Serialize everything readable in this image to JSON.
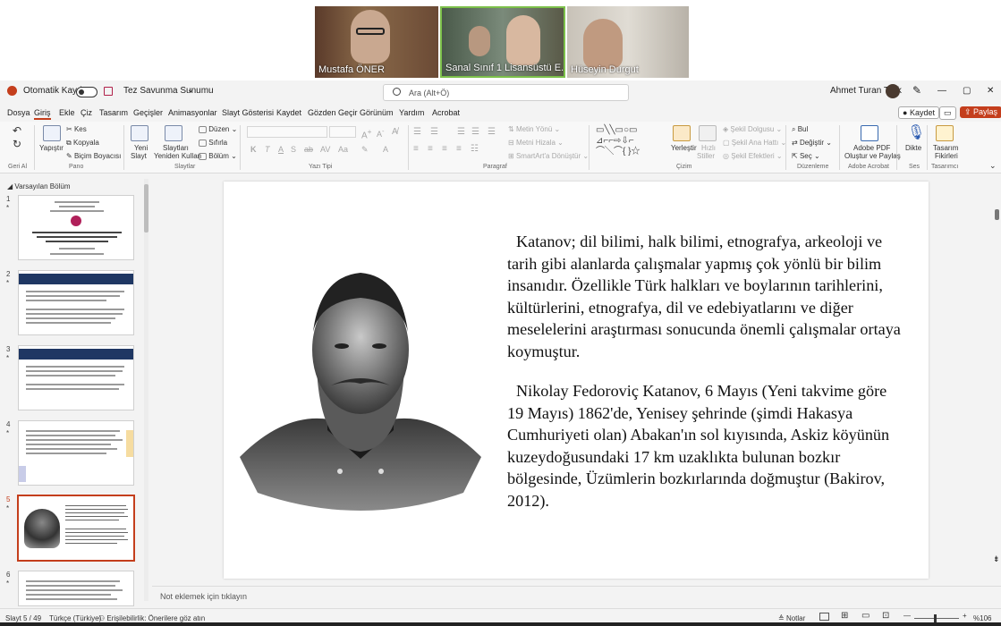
{
  "meeting": {
    "participants": [
      {
        "name": "Mustafa ÖNER"
      },
      {
        "name": "Sanal Sınıf 1 Lisansüstü E..."
      },
      {
        "name": "Hüseyin Durgut"
      }
    ]
  },
  "titlebar": {
    "autosave_label": "Otomatik Kaydet",
    "doc_title": "Tez Savunma Sunumu",
    "search_placeholder": "Ara (Alt+Ö)",
    "user_name": "Ahmet Turan Türk",
    "minimize": "—",
    "restore": "▢",
    "close": "✕"
  },
  "menu": {
    "items": [
      "Dosya",
      "Giriş",
      "Ekle",
      "Çiz",
      "Tasarım",
      "Geçişler",
      "Animasyonlar",
      "Slayt Gösterisi",
      "Kaydet",
      "Gözden Geçir",
      "Görünüm",
      "Yardım",
      "Acrobat"
    ],
    "record_label": "Kaydet",
    "share_label": "Paylaş"
  },
  "ribbon": {
    "undo_group": "Geri Al",
    "clipboard": {
      "paste": "Yapıştır",
      "cut": "Kes",
      "copy": "Kopyala",
      "format_painter": "Biçim Boyacısı",
      "group": "Pano"
    },
    "slides": {
      "new_slide": "Yeni",
      "new_slide2": "Slayt",
      "reuse": "Slaytları",
      "reuse2": "Yeniden Kullan",
      "layout": "Düzen",
      "reset": "Sıfırla",
      "section": "Bölüm",
      "group": "Slaytlar"
    },
    "font": {
      "group": "Yazı Tipi"
    },
    "paragraph": {
      "text_direction": "Metin Yönü",
      "align_text": "Metni Hizala",
      "smartart": "SmartArt'a Dönüştür",
      "group": "Paragraf"
    },
    "drawing": {
      "arrange": "Yerleştir",
      "quick_styles": "Hızlı",
      "quick_styles2": "Stiller",
      "shape_fill": "Şekil Dolgusu",
      "shape_outline": "Şekil Ana Hattı",
      "shape_effects": "Şekil Efektleri",
      "group": "Çizim"
    },
    "editing": {
      "find": "Bul",
      "replace": "Değiştir",
      "select": "Seç",
      "group": "Düzenleme"
    },
    "acrobat": {
      "create_pdf": "Adobe PDF",
      "create_pdf2": "Oluştur ve Paylaş",
      "group": "Adobe Acrobat"
    },
    "voice": {
      "dictate": "Dikte",
      "group": "Ses"
    },
    "designer": {
      "label": "Tasarım",
      "label2": "Fikirleri",
      "group": "Tasarımcı"
    }
  },
  "left_panel": {
    "section_label": "Varsayılan Bölüm",
    "slide_numbers": [
      "1",
      "2",
      "3",
      "4",
      "5",
      "6"
    ],
    "selected_slide": 5
  },
  "slide": {
    "paragraph1": "Katanov; dil bilimi, halk bilimi, etnografya, arkeoloji ve tarih gibi alanlarda çalışmalar yapmış çok yönlü bir bilim insanıdır. Özellikle Türk halkları ve boylarının tarihlerini, kültürlerini, etnografya, dil ve edebiyatlarını ve diğer meselelerini araştırması sonucunda önemli çalışmalar ortaya koymuştur.",
    "paragraph2": "Nikolay Fedoroviç Katanov, 6 Mayıs (Yeni takvime göre 19 Mayıs) 1862'de, Yenisey şehrinde (şimdi Hakasya Cumhuriyeti olan) Abakan'ın sol kıyısında, Askiz köyünün kuzeydoğusundaki 17 km uzaklıkta bulunan bozkır bölgesinde, Üzümlerin bozkırlarında doğmuştur (Bakirov, 2012)."
  },
  "notes_placeholder": "Not eklemek için tıklayın",
  "status": {
    "slide_counter": "Slayt 5 / 49",
    "language": "Türkçe (Türkiye)",
    "accessibility": "Erişilebilirlik: Önerilere göz atın",
    "notes_button": "Notlar",
    "zoom": "%106"
  }
}
